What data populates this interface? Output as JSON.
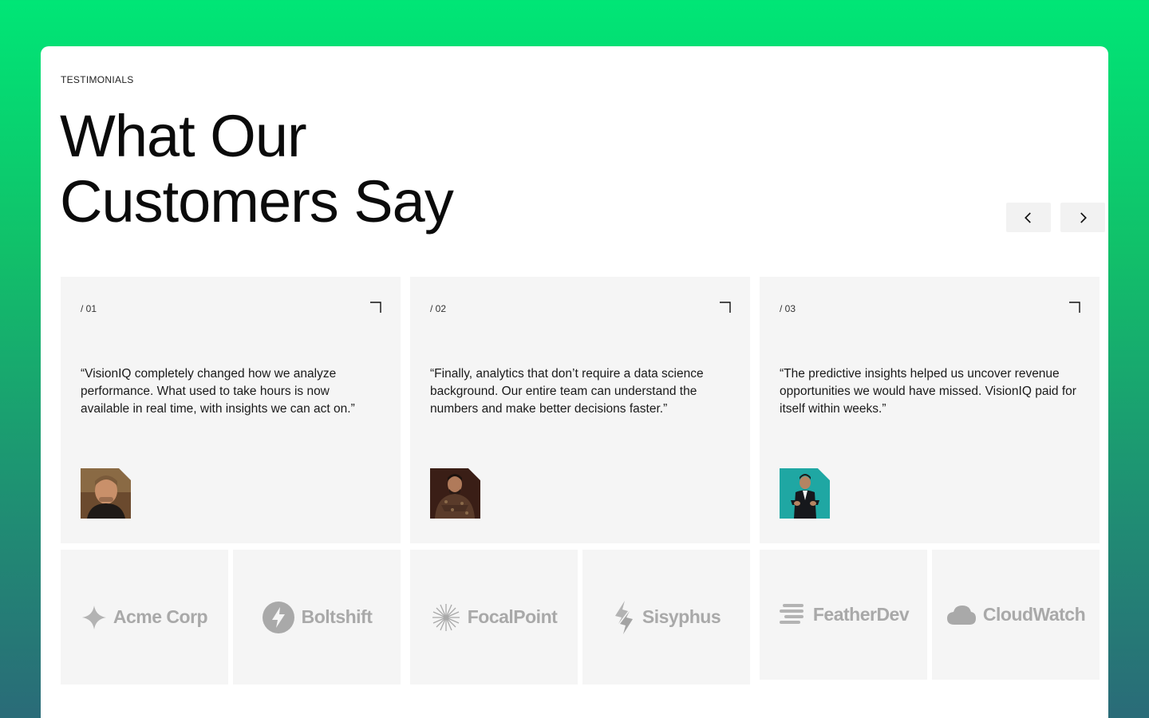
{
  "section": {
    "eyebrow": "TESTIMONIALS",
    "title_line1": "What Our",
    "title_line2": "Customers Say"
  },
  "nav": {
    "prev_icon": "chevron-left-icon",
    "next_icon": "chevron-right-icon"
  },
  "testimonials": [
    {
      "index": "/ 01",
      "quote": "“VisionIQ completely changed how we analyze performance. What used to take hours is now available in real time, with insights we can act on.”"
    },
    {
      "index": "/ 02",
      "quote": "“Finally, analytics that don’t require a data science background. Our entire team can understand the numbers and make better decisions faster.”"
    },
    {
      "index": "/ 03",
      "quote": "“The predictive insights helped us uncover revenue opportunities we would have missed. VisionIQ paid for itself within weeks.”"
    }
  ],
  "logos": [
    {
      "name": "Acme Corp",
      "icon": "sparkle-icon"
    },
    {
      "name": "Boltshift",
      "icon": "bolt-icon"
    },
    {
      "name": "FocalPoint",
      "icon": "starburst-icon"
    },
    {
      "name": "Sisyphus",
      "icon": "sisyphus-icon"
    },
    {
      "name": "FeatherDev",
      "icon": "feather-icon"
    },
    {
      "name": "CloudWatch",
      "icon": "cloud-icon"
    }
  ],
  "colors": {
    "background_top": "#00e676",
    "background_bottom": "#2a6b78",
    "card": "#f5f5f5",
    "logo_gray": "#a9a9a9"
  }
}
